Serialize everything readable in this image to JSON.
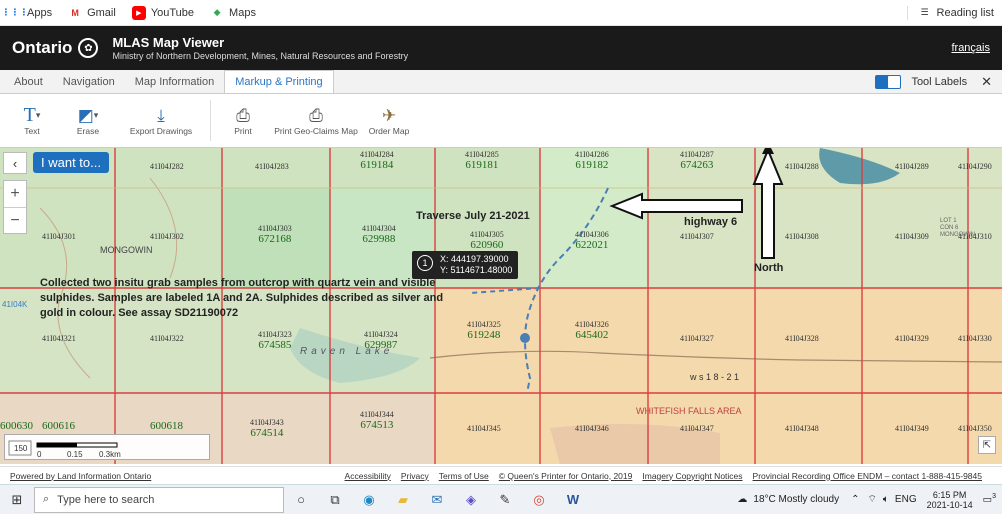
{
  "bookmarks": {
    "items": [
      {
        "label": "Apps",
        "icon": "apps-grid-icon",
        "color": "#1a73e8"
      },
      {
        "label": "Gmail",
        "icon": "gmail-icon",
        "color": "#d93025"
      },
      {
        "label": "YouTube",
        "icon": "youtube-icon",
        "color": "#ff0000"
      },
      {
        "label": "Maps",
        "icon": "maps-icon",
        "color": "#34a853"
      }
    ],
    "reading_list": "Reading list"
  },
  "header": {
    "brand": "Ontario",
    "title": "MLAS Map Viewer",
    "subtitle": "Ministry of Northern Development, Mines, Natural Resources and Forestry",
    "lang_link": "français"
  },
  "tabs": {
    "items": [
      "About",
      "Navigation",
      "Map Information",
      "Markup & Printing"
    ],
    "active": "Markup & Printing",
    "tool_labels": "Tool Labels"
  },
  "toolbar": {
    "text": "Text",
    "erase": "Erase",
    "export": "Export Drawings",
    "print": "Print",
    "print_geo": "Print Geo-Claims Map",
    "order": "Order Map"
  },
  "map": {
    "i_want": "I want to...",
    "popup": {
      "number": "1",
      "x": "X: 444197.39000",
      "y": "Y: 5114671.48000"
    },
    "note": "Collected two insitu grab samples from outcrop with quartz vein and visible sulphides. Samples are labeled 1A and 2A. Sulphides described as silver and gold in colour. See assay SD21190072",
    "traverse": "Traverse July 21-2021",
    "highway": "highway 6",
    "north": "North",
    "mongowin": "MONGOWIN",
    "raven_lake": "Raven Lake",
    "whitefish": "WHITEFISH FALLS AREA",
    "ws": "w s 1 8 - 2 1",
    "lot_label": "LOT 1\nCON 6\nMONGOWIN",
    "left_edge": "41I04K",
    "cells": [
      {
        "id": "41I04J284",
        "claim": "619184"
      },
      {
        "id": "41I04J285",
        "claim": "619181"
      },
      {
        "id": "41I04J286",
        "claim": "619182"
      },
      {
        "id": "41I04J287",
        "claim": "674263"
      },
      {
        "id": "41I04J282"
      },
      {
        "id": "41I04J283"
      },
      {
        "id": "41I04J288"
      },
      {
        "id": "41I04J289"
      },
      {
        "id": "41I04J290"
      },
      {
        "id": "41I04J301"
      },
      {
        "id": "41I04J302"
      },
      {
        "id": "41I04J303",
        "claim": "672168"
      },
      {
        "id": "41I04J304",
        "claim": "629988"
      },
      {
        "id": "41I04J305",
        "claim": "620960"
      },
      {
        "id": "41I04J306",
        "claim": "622021"
      },
      {
        "id": "41I04J307"
      },
      {
        "id": "41I04J308"
      },
      {
        "id": "41I04J309"
      },
      {
        "id": "41I04J310"
      },
      {
        "id": "41I04J321"
      },
      {
        "id": "41I04J322"
      },
      {
        "id": "41I04J323",
        "claim": "674585"
      },
      {
        "id": "41I04J324",
        "claim": "629987"
      },
      {
        "id": "41I04J325",
        "claim": "619248"
      },
      {
        "id": "41I04J326",
        "claim": "645402"
      },
      {
        "id": "41I04J327"
      },
      {
        "id": "41I04J328"
      },
      {
        "id": "41I04J329"
      },
      {
        "id": "41I04J330"
      },
      {
        "claim": "600630"
      },
      {
        "claim": "600616"
      },
      {
        "claim": "600618"
      },
      {
        "id": "41I04J343",
        "claim": "674514"
      },
      {
        "id": "41I04J344",
        "claim": "674513"
      },
      {
        "id": "41I04J345"
      },
      {
        "id": "41I04J346"
      },
      {
        "id": "41I04J347"
      },
      {
        "id": "41I04J348"
      },
      {
        "id": "41I04J349"
      },
      {
        "id": "41I04J350"
      }
    ],
    "scale": {
      "l0": "0",
      "l1": "0.15",
      "l2": "0.3km",
      "ft": "150"
    }
  },
  "footer": {
    "powered": "Powered by Land Information Ontario",
    "links": [
      "Accessibility",
      "Privacy",
      "Terms of Use",
      "© Queen's Printer for Ontario, 2019",
      "Imagery Copyright Notices",
      "Provincial Recording Office ENDM – contact 1-888-415-9845"
    ]
  },
  "taskbar": {
    "search_placeholder": "Type here to search",
    "weather": "18°C  Mostly cloudy",
    "lang": "ENG",
    "time": "6:15 PM",
    "date": "2021-10-14",
    "notif": "3"
  }
}
